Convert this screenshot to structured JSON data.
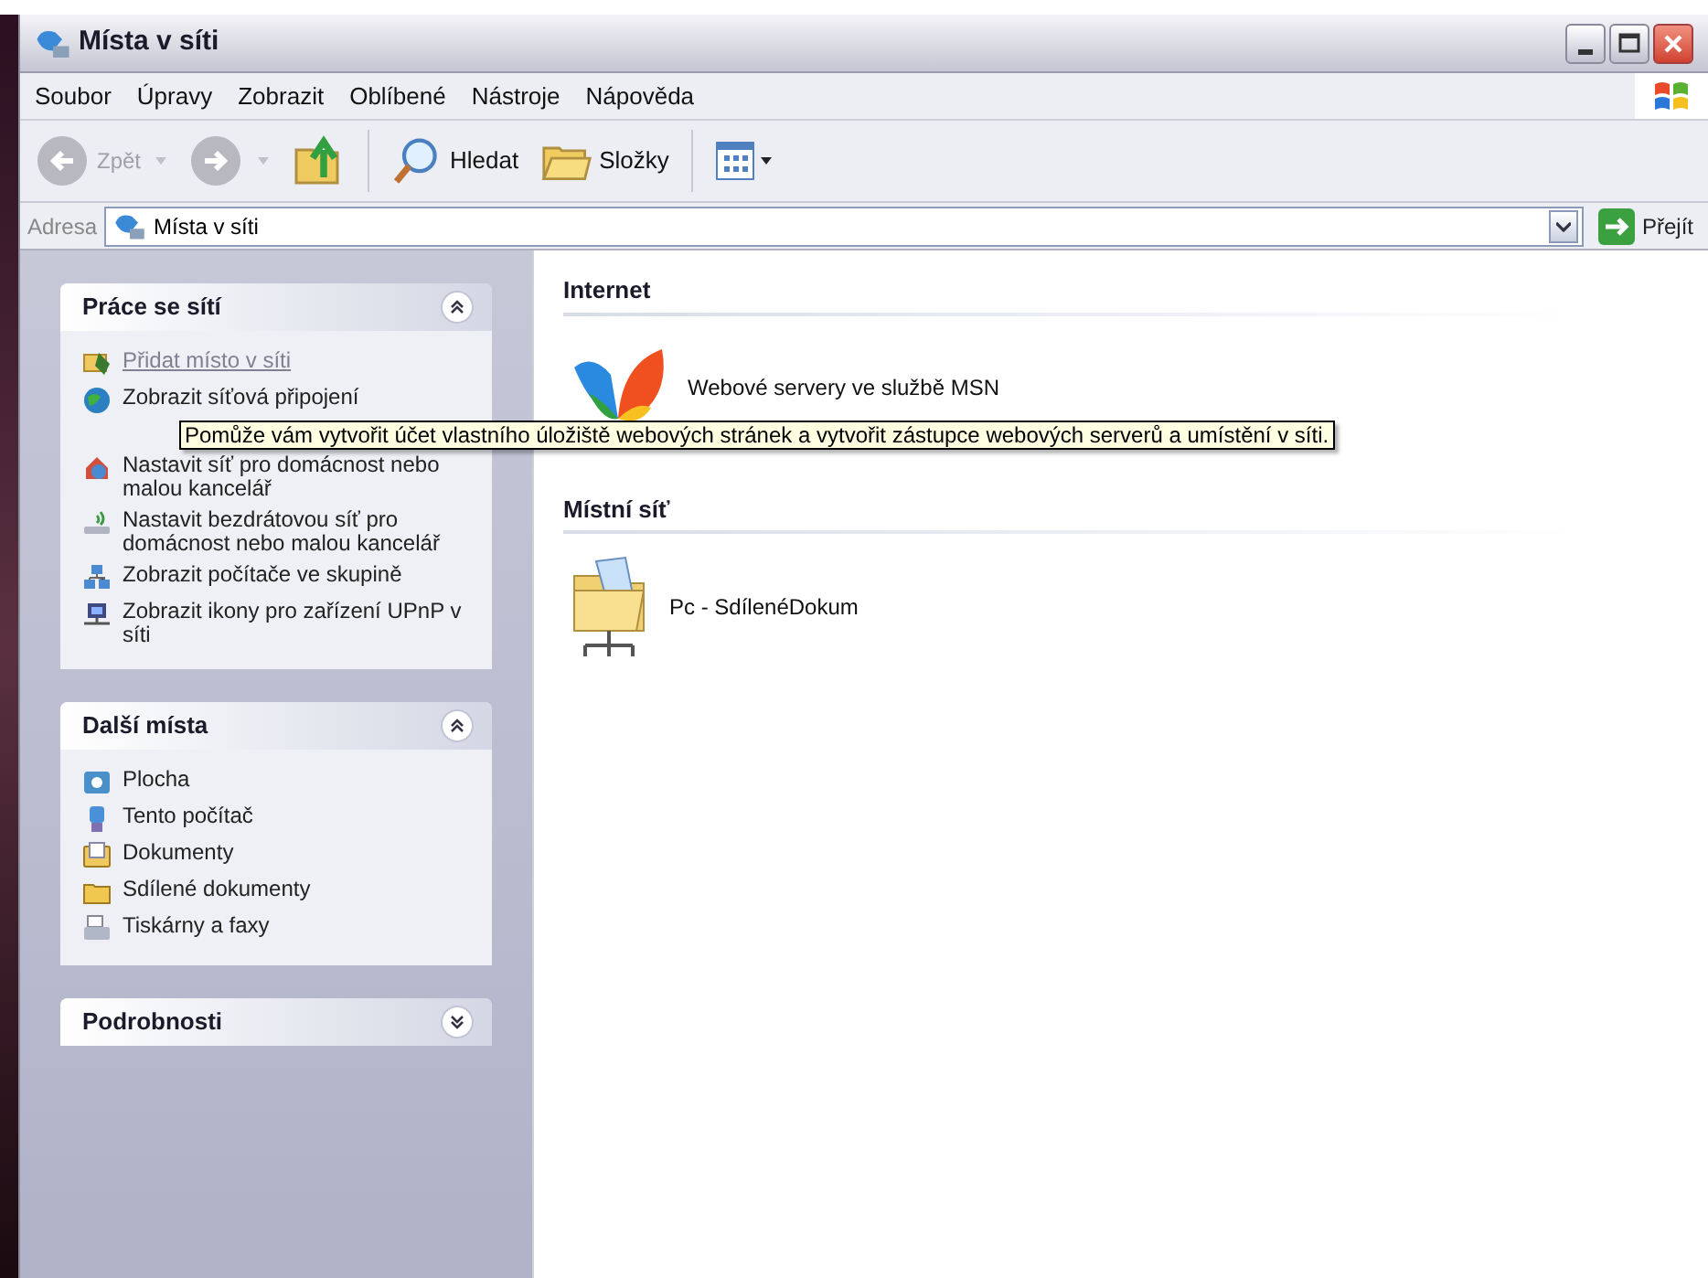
{
  "window": {
    "title": "Místa v síti"
  },
  "menu": [
    "Soubor",
    "Úpravy",
    "Zobrazit",
    "Oblíbené",
    "Nástroje",
    "Nápověda"
  ],
  "toolbar": [
    {
      "kind": "back",
      "label": "Zpět",
      "disabled": true
    },
    {
      "kind": "forward",
      "disabled": true
    },
    {
      "kind": "up",
      "disabled": false
    },
    {
      "kind": "search",
      "label": "Hledat"
    },
    {
      "kind": "folders",
      "label": "Složky"
    },
    {
      "kind": "views"
    }
  ],
  "address": {
    "label": "Adresa",
    "value": "Místa v síti",
    "go_label": "Přejít"
  },
  "sidebar": [
    {
      "title": "Práce se sítí",
      "expanded": true,
      "items": [
        {
          "label": "Přidat místo v síti",
          "hovered": true
        },
        {
          "label": "Zobrazit síťová připojení",
          "hovered": false
        },
        {
          "label": "Nastavit síť pro domácnost nebo malou kancelář",
          "hovered": false
        },
        {
          "label": "Nastavit bezdrátovou síť pro domácnost nebo malou kancelář",
          "hovered": false
        },
        {
          "label": "Zobrazit počítače ve skupině",
          "hovered": false
        },
        {
          "label": "Zobrazit ikony pro zařízení UPnP v síti",
          "hovered": false
        }
      ]
    },
    {
      "title": "Další místa",
      "expanded": true,
      "items": [
        {
          "label": "Plocha",
          "hovered": false
        },
        {
          "label": "Tento počítač",
          "hovered": false
        },
        {
          "label": "Dokumenty",
          "hovered": false
        },
        {
          "label": "Sdílené dokumenty",
          "hovered": false
        },
        {
          "label": "Tiskárny a faxy",
          "hovered": false
        }
      ]
    },
    {
      "title": "Podrobnosti",
      "expanded": false
    }
  ],
  "tooltip": "Pomůže vám vytvořit účet vlastního úložiště webových stránek a vytvořit zástupce webových serverů a umístění v síti.",
  "groups": [
    {
      "title": "Internet",
      "items": [
        {
          "label": "Webové servery ve službě MSN"
        }
      ]
    },
    {
      "title": "Místní síť",
      "items": [
        {
          "label": "Pc - SdílenéDokum"
        }
      ]
    }
  ]
}
